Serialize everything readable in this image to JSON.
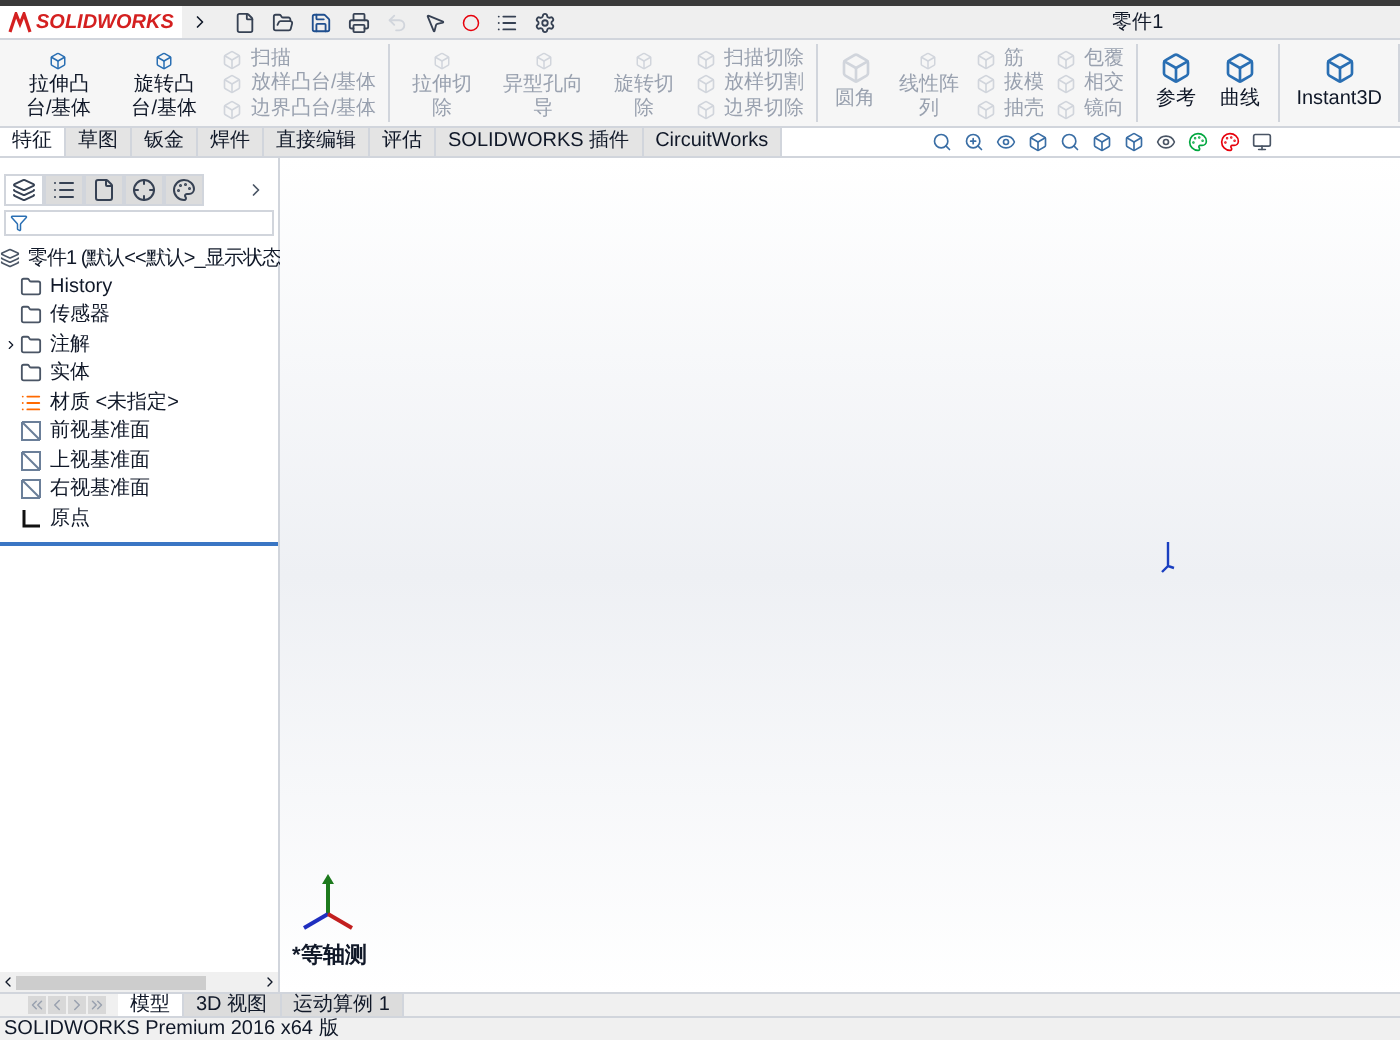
{
  "window": {
    "title": "零件1",
    "logo": "SOLIDWORKS"
  },
  "ribbon": {
    "groups": [
      {
        "tools": [
          {
            "label": "拉伸凸台/基体",
            "kind": "large",
            "disabled": false
          },
          {
            "label": "旋转凸台/基体",
            "kind": "large",
            "disabled": false
          },
          {
            "label": "扫描",
            "kind": "small",
            "disabled": true
          },
          {
            "label": "放样凸台/基体",
            "kind": "small",
            "disabled": true
          },
          {
            "label": "边界凸台/基体",
            "kind": "small",
            "disabled": true
          }
        ]
      },
      {
        "tools": [
          {
            "label": "拉伸切除",
            "kind": "large",
            "disabled": true
          },
          {
            "label": "异型孔向导",
            "kind": "large",
            "disabled": true
          },
          {
            "label": "旋转切除",
            "kind": "large",
            "disabled": true
          },
          {
            "label": "扫描切除",
            "kind": "small",
            "disabled": true
          },
          {
            "label": "放样切割",
            "kind": "small",
            "disabled": true
          },
          {
            "label": "边界切除",
            "kind": "small",
            "disabled": true
          }
        ]
      },
      {
        "tools": [
          {
            "label": "圆角",
            "kind": "large",
            "disabled": true
          },
          {
            "label": "线性阵列",
            "kind": "large",
            "disabled": true
          },
          {
            "label": "筋",
            "kind": "small",
            "disabled": true
          },
          {
            "label": "拔模",
            "kind": "small",
            "disabled": true
          },
          {
            "label": "抽壳",
            "kind": "small",
            "disabled": true
          },
          {
            "label": "包覆",
            "kind": "small",
            "disabled": true
          },
          {
            "label": "相交",
            "kind": "small",
            "disabled": true
          },
          {
            "label": "镜向",
            "kind": "small",
            "disabled": true
          }
        ]
      },
      {
        "tools": [
          {
            "label": "参考",
            "kind": "large",
            "disabled": false
          },
          {
            "label": "曲线",
            "kind": "large",
            "disabled": false
          }
        ]
      },
      {
        "tools": [
          {
            "label": "Instant3D",
            "kind": "large",
            "disabled": false
          }
        ]
      }
    ]
  },
  "command_tabs": [
    {
      "label": "特征",
      "selected": true
    },
    {
      "label": "草图",
      "selected": false
    },
    {
      "label": "钣金",
      "selected": false
    },
    {
      "label": "焊件",
      "selected": false
    },
    {
      "label": "直接编辑",
      "selected": false
    },
    {
      "label": "评估",
      "selected": false
    },
    {
      "label": "SOLIDWORKS 插件",
      "selected": false
    },
    {
      "label": "CircuitWorks",
      "selected": false
    }
  ],
  "panel_tabs": [
    {
      "kind": "feature",
      "selected": true
    },
    {
      "kind": "property",
      "selected": false
    },
    {
      "kind": "config",
      "selected": false
    },
    {
      "kind": "dimension",
      "selected": false
    },
    {
      "kind": "display",
      "selected": false
    }
  ],
  "tree": {
    "root": "零件1 (默认<<默认>_显示状态",
    "children": [
      {
        "label": "History",
        "kind": "folder"
      },
      {
        "label": "传感器",
        "kind": "folder"
      },
      {
        "label": "注解",
        "kind": "folder",
        "expanded": false
      },
      {
        "label": "实体",
        "kind": "folder"
      },
      {
        "label": "材质 <未指定>",
        "kind": "material"
      },
      {
        "label": "前视基准面",
        "kind": "plane"
      },
      {
        "label": "上视基准面",
        "kind": "plane"
      },
      {
        "label": "右视基准面",
        "kind": "plane"
      },
      {
        "label": "原点",
        "kind": "origin"
      }
    ]
  },
  "viewport": {
    "view_label": "*等轴测"
  },
  "bottom_tabs": [
    {
      "label": "模型",
      "selected": true
    },
    {
      "label": "3D 视图",
      "selected": false
    },
    {
      "label": "运动算例 1",
      "selected": false
    }
  ],
  "status_bar": "SOLIDWORKS Premium 2016 x64 版"
}
